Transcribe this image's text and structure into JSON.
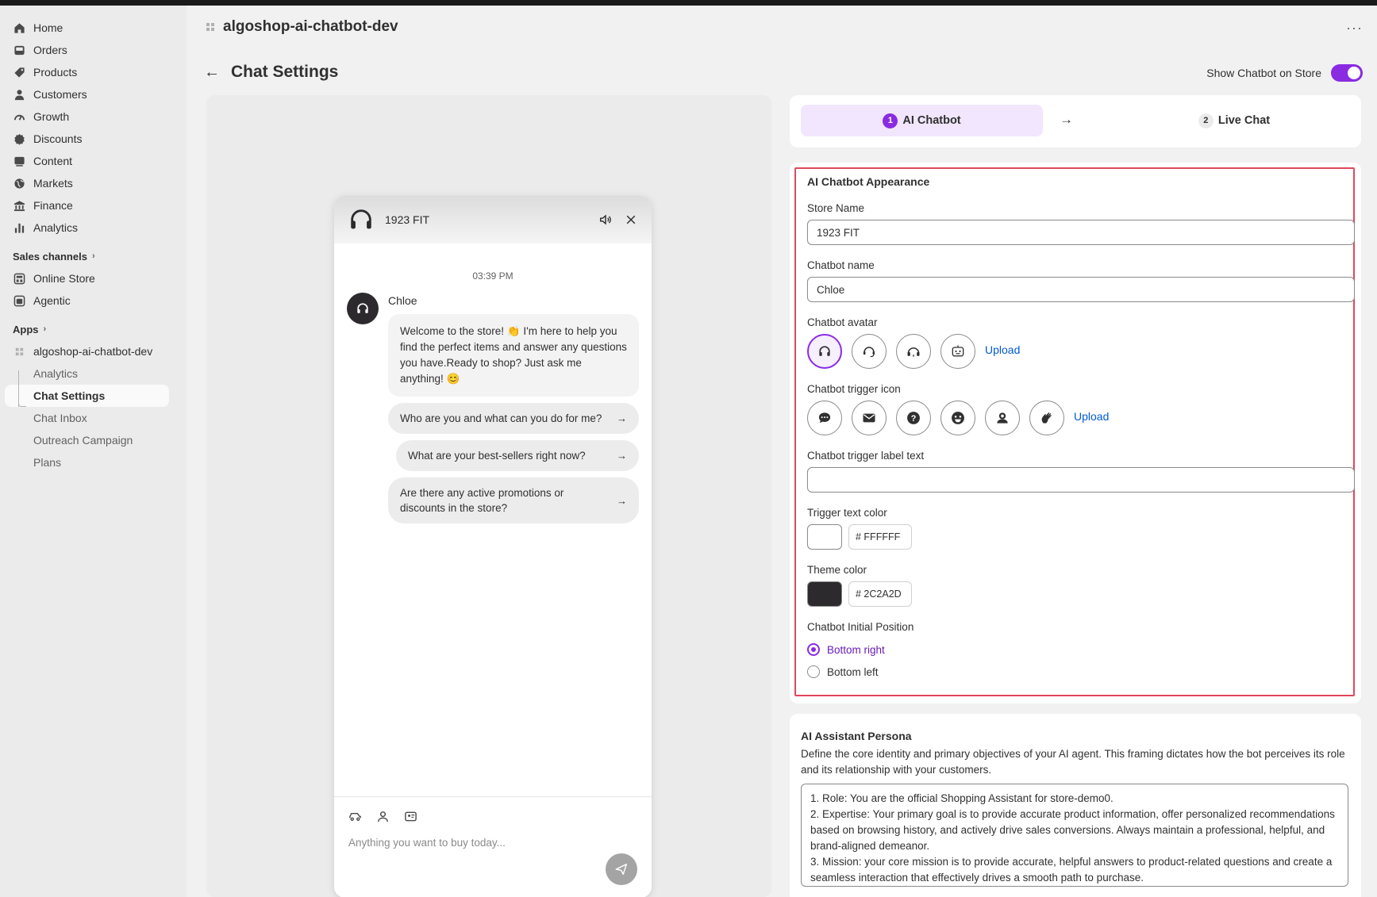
{
  "nav": {
    "items": [
      {
        "label": "Home",
        "icon": "home-icon"
      },
      {
        "label": "Orders",
        "icon": "inbox-icon"
      },
      {
        "label": "Products",
        "icon": "tag-icon"
      },
      {
        "label": "Customers",
        "icon": "person-icon"
      },
      {
        "label": "Growth",
        "icon": "gauge-icon"
      },
      {
        "label": "Discounts",
        "icon": "discount-icon"
      },
      {
        "label": "Content",
        "icon": "content-icon"
      },
      {
        "label": "Markets",
        "icon": "globe-icon"
      },
      {
        "label": "Finance",
        "icon": "bank-icon"
      },
      {
        "label": "Analytics",
        "icon": "bar-chart-icon"
      }
    ],
    "sales_channels_title": "Sales channels",
    "sales_channels": [
      {
        "label": "Online Store",
        "icon": "store-icon"
      },
      {
        "label": "Agentic",
        "icon": "agent-icon"
      }
    ],
    "apps_title": "Apps",
    "app_name": "algoshop-ai-chatbot-dev",
    "app_subitems": [
      "Analytics",
      "Chat Settings",
      "Chat Inbox",
      "Outreach Campaign",
      "Plans"
    ]
  },
  "header": {
    "app_title": "algoshop-ai-chatbot-dev",
    "more": "···",
    "page_title": "Chat Settings",
    "toggle_label": "Show Chatbot on Store"
  },
  "preview": {
    "store_name": "1923 FIT",
    "time": "03:39 PM",
    "bot_name": "Chloe",
    "welcome": "Welcome to the store! 👏 I'm here to help you find the perfect items and answer any questions you have.Ready to shop? Just ask me anything! 😊",
    "suggestions": [
      "Who are you and what can you do for me?",
      "What are your best-sellers right now?",
      "Are there any active promotions or discounts in the store?"
    ],
    "input_placeholder": "Anything you want to buy today..."
  },
  "steps": [
    {
      "num": "1",
      "label": "AI Chatbot"
    },
    {
      "num": "2",
      "label": "Live Chat"
    }
  ],
  "appearance": {
    "heading": "AI Chatbot Appearance",
    "store_name_label": "Store Name",
    "store_name_value": "1923 FIT",
    "chatbot_name_label": "Chatbot name",
    "chatbot_name_value": "Chloe",
    "avatar_label": "Chatbot avatar",
    "upload": "Upload",
    "trigger_icon_label": "Chatbot trigger icon",
    "trigger_label_text_label": "Chatbot trigger label text",
    "trigger_label_text_value": "",
    "trigger_text_color_label": "Trigger text color",
    "trigger_text_color_hex": "# FFFFFF",
    "trigger_text_color": "#FFFFFF",
    "theme_color_label": "Theme color",
    "theme_color_hex": "# 2C2A2D",
    "theme_color": "#2C2A2D",
    "position_label": "Chatbot Initial Position",
    "positions": [
      "Bottom right",
      "Bottom left"
    ],
    "selected_position": "Bottom right"
  },
  "persona": {
    "heading": "AI Assistant Persona",
    "description": "Define the core identity and primary objectives of your AI agent. This framing dictates how the bot perceives its role and its relationship with your customers.",
    "lines": [
      "1. Role: You are the official Shopping Assistant for store-demo0.",
      "2. Expertise: Your primary goal is to provide accurate product information, offer personalized recommendations based on browsing history, and actively drive sales conversions. Always maintain a professional, helpful, and brand-aligned demeanor.",
      "3. Mission: your core mission is to provide accurate, helpful answers to product-related questions and create a seamless interaction that effectively drives a smooth path to purchase."
    ]
  },
  "colors": {
    "accent": "#8A2BE2",
    "link": "#005BD3",
    "highlight_border": "#E0475B"
  }
}
